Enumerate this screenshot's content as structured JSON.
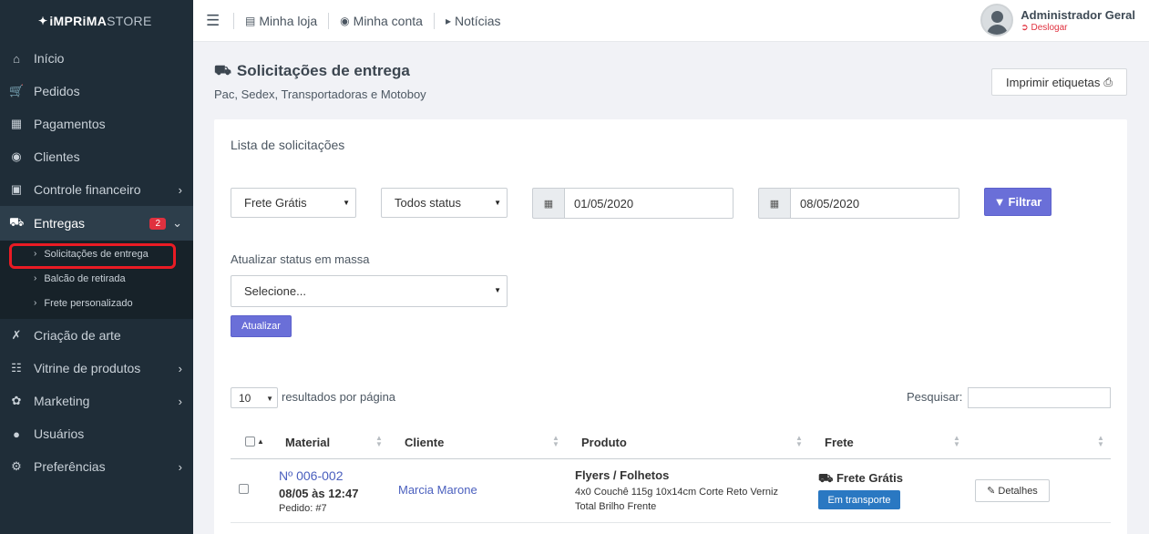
{
  "brand": {
    "name_bold": "iMPRiMA",
    "name_light": "STORE"
  },
  "sidebar": {
    "items": [
      {
        "label": "Início",
        "icon": "home-icon"
      },
      {
        "label": "Pedidos",
        "icon": "cart-icon"
      },
      {
        "label": "Pagamentos",
        "icon": "file-icon"
      },
      {
        "label": "Clientes",
        "icon": "user-circle-icon"
      },
      {
        "label": "Controle financeiro",
        "icon": "bank-icon"
      },
      {
        "label": "Entregas",
        "icon": "truck-icon",
        "badge": "2"
      },
      {
        "label": "Criação de arte",
        "icon": "tools-icon"
      },
      {
        "label": "Vitrine de produtos",
        "icon": "sitemap-icon"
      },
      {
        "label": "Marketing",
        "icon": "leaf-icon"
      },
      {
        "label": "Usuários",
        "icon": "male-icon"
      },
      {
        "label": "Preferências",
        "icon": "gears-icon"
      }
    ],
    "subitems": [
      {
        "label": "Solicitações de entrega"
      },
      {
        "label": "Balcão de retirada"
      },
      {
        "label": "Frete personalizado"
      }
    ]
  },
  "topbar": {
    "links": [
      "Minha loja",
      "Minha conta",
      "Notícias"
    ],
    "user_name": "Administrador Geral",
    "logout": "Deslogar"
  },
  "page": {
    "title": "Solicitações de entrega",
    "subtitle": "Pac, Sedex, Transportadoras e Motoboy",
    "print_button": "Imprimir etiquetas"
  },
  "card": {
    "title": "Lista de solicitações",
    "filters": {
      "frete_select": "Frete Grátis",
      "status_select": "Todos status",
      "date_from": "01/05/2020",
      "date_to": "08/05/2020",
      "filter_button": "Filtrar"
    },
    "bulk": {
      "label": "Atualizar status em massa",
      "select": "Selecione...",
      "button": "Atualizar"
    },
    "table_controls": {
      "page_length": "10",
      "page_length_label": "resultados por página",
      "search_label": "Pesquisar:"
    },
    "columns": [
      "Material",
      "Cliente",
      "Produto",
      "Frete"
    ],
    "rows": [
      {
        "material_id": "Nº 006-002",
        "material_date": "08/05 às 12:47",
        "order": "Pedido: #7",
        "client": "Marcia Marone",
        "product_name": "Flyers / Folhetos",
        "product_desc_1": "4x0 Couchê 115g 10x14cm Corte Reto Verniz",
        "product_desc_2": "Total Brilho Frente",
        "shipping": "Frete Grátis",
        "status": "Em transporte",
        "details_button": "Detalhes"
      }
    ]
  },
  "colors": {
    "sidebar_bg": "#1f2d38",
    "primary": "#6a6fd8",
    "status_blue": "#2a78c2",
    "badge_red": "#e0313f"
  }
}
